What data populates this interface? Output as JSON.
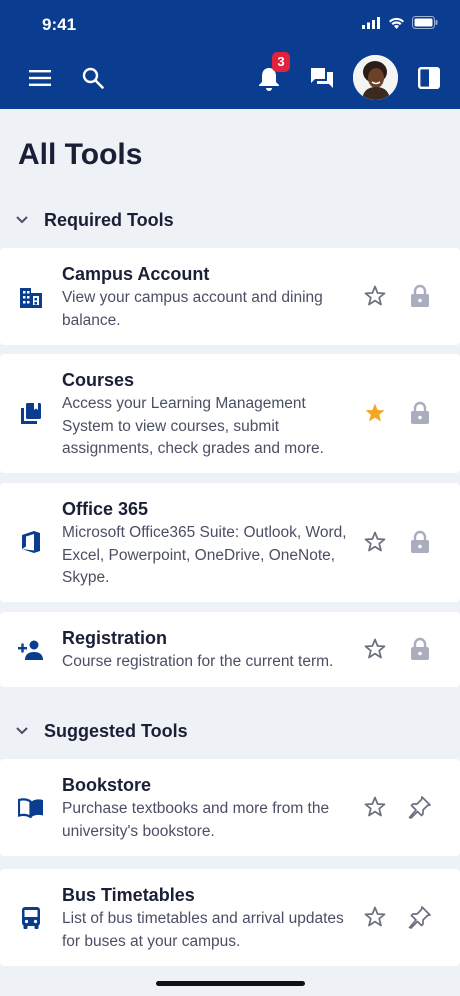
{
  "status_bar": {
    "time": "9:41"
  },
  "header": {
    "notification_count": "3"
  },
  "page": {
    "title": "All Tools"
  },
  "sections": [
    {
      "label": "Required Tools"
    },
    {
      "label": "Suggested Tools"
    }
  ],
  "tools": [
    {
      "title": "Campus Account",
      "desc": "View your campus account and dining balance.",
      "icon": "building-icon",
      "favorite": false,
      "action": "lock-icon"
    },
    {
      "title": "Courses",
      "desc": "Access your Learning Management System to view courses, submit assignments, check grades and more.",
      "icon": "book-stack-icon",
      "favorite": true,
      "action": "lock-icon"
    },
    {
      "title": "Office 365",
      "desc": "Microsoft Office365 Suite: Outlook, Word, Excel, Powerpoint, OneDrive, OneNote, Skype.",
      "icon": "office-icon",
      "favorite": false,
      "action": "lock-icon"
    },
    {
      "title": "Registration",
      "desc": "Course registration for the current term.",
      "icon": "person-add-icon",
      "favorite": false,
      "action": "lock-icon"
    },
    {
      "title": "Bookstore",
      "desc": "Purchase textbooks and more from the university's bookstore.",
      "icon": "open-book-icon",
      "favorite": false,
      "action": "pin-icon"
    },
    {
      "title": "Bus Timetables",
      "desc": "List of bus timetables and arrival updates for buses at your campus.",
      "icon": "bus-icon",
      "favorite": false,
      "action": "pin-icon"
    }
  ],
  "colors": {
    "header_bg": "#0a3d8f",
    "star_active": "#f5a623",
    "icon_navy": "#0a3d8f",
    "lock_gray": "#a9adbd"
  }
}
